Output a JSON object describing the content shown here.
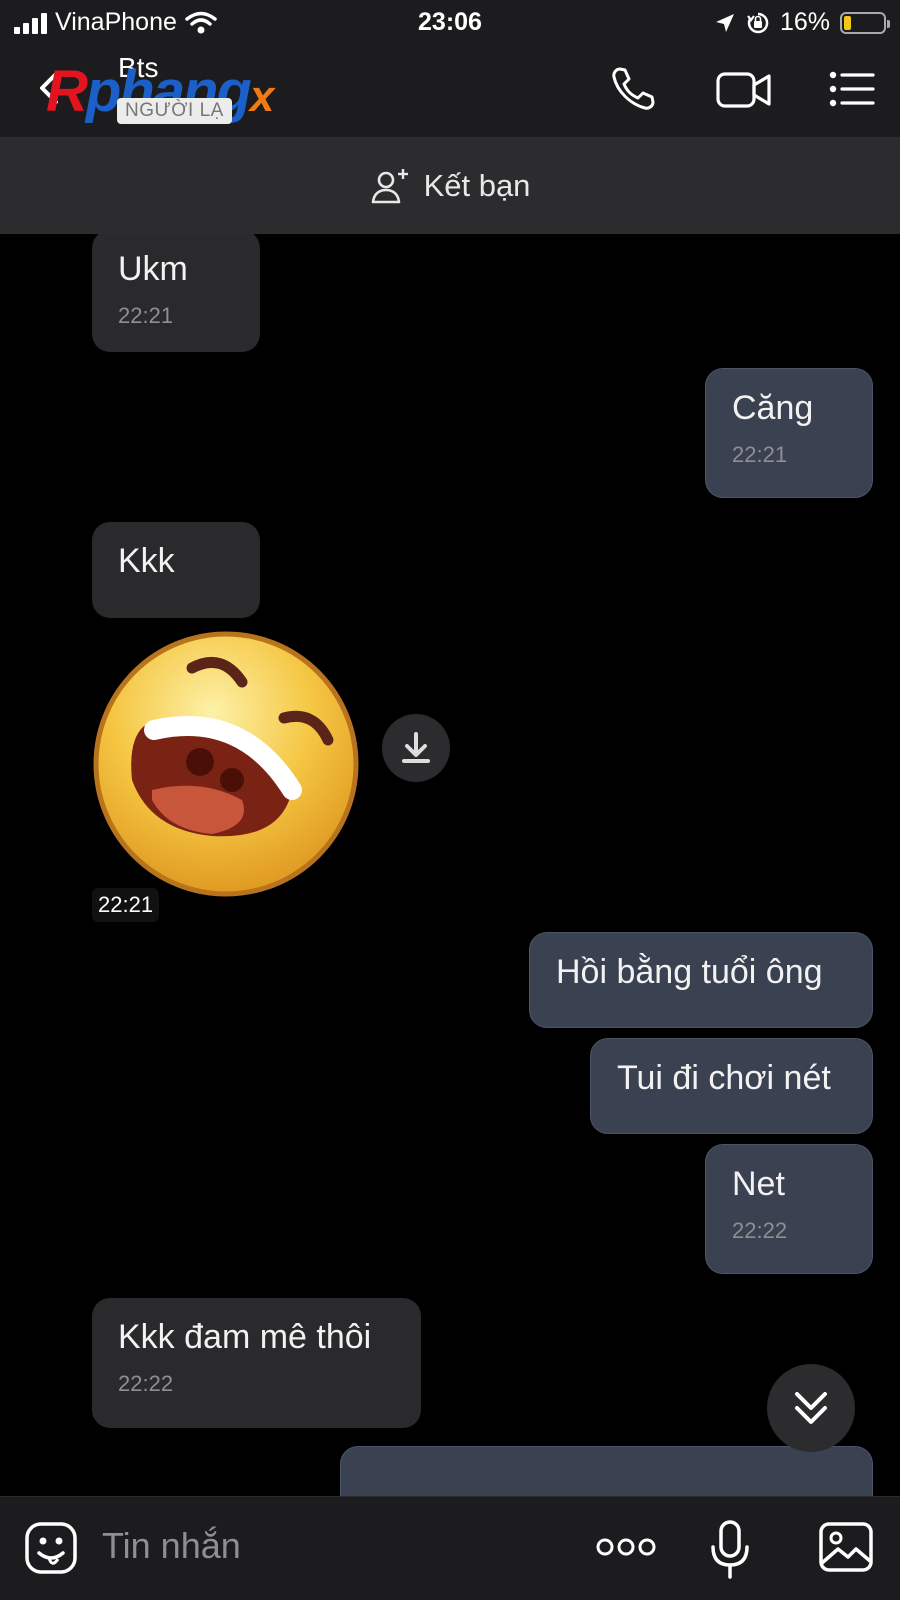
{
  "status_bar": {
    "carrier": "VinaPhone",
    "time": "23:06",
    "battery": "16%",
    "battery_level": 0.16
  },
  "header": {
    "contact_name": "Bts",
    "stranger_badge": "NGƯỜI LẠ",
    "watermark": "Rphangx",
    "back_icon": "chevron-left-icon",
    "call_icon": "phone-icon",
    "video_icon": "video-call-icon",
    "menu_icon": "list-menu-icon"
  },
  "add_friend": {
    "label": "Kết bạn",
    "icon": "add-user-icon"
  },
  "messages": [
    {
      "dir": "in",
      "text": "Ukm",
      "time": "22:21"
    },
    {
      "dir": "out",
      "text": "Căng",
      "time": "22:21"
    },
    {
      "dir": "in",
      "text": "Kkk",
      "time": ""
    },
    {
      "dir": "in",
      "type": "sticker",
      "sticker": "laughing-face",
      "time": "22:21"
    },
    {
      "dir": "out",
      "text": "Hồi bằng tuổi ông",
      "time": ""
    },
    {
      "dir": "out",
      "text": "Tui đi chơi nét",
      "time": ""
    },
    {
      "dir": "out",
      "text": "Net",
      "time": "22:22"
    },
    {
      "dir": "in",
      "text": "Kkk đam mê thôi",
      "time": "22:22"
    }
  ],
  "input_bar": {
    "placeholder": "Tin nhắn",
    "sticker_icon": "emoji-icon",
    "more_icon": "more-dots-icon",
    "mic_icon": "microphone-icon",
    "image_icon": "image-icon"
  },
  "colors": {
    "background": "#000000",
    "incoming_bubble": "#2a2a2c",
    "outgoing_bubble": "#3a4150",
    "bar": "#1c1c1e"
  }
}
